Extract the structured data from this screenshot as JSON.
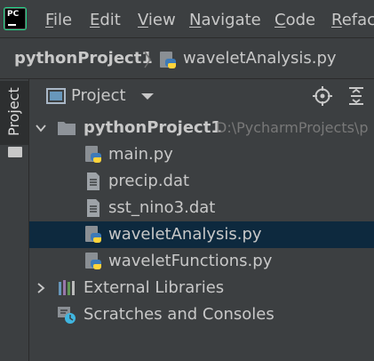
{
  "menu": {
    "items": [
      {
        "label": "File"
      },
      {
        "label": "Edit"
      },
      {
        "label": "View"
      },
      {
        "label": "Navigate"
      },
      {
        "label": "Code"
      },
      {
        "label": "Refac"
      }
    ]
  },
  "breadcrumb": {
    "project": "pythonProject1",
    "file": "waveletAnalysis.py"
  },
  "toolstrip": {
    "tab_label": "Project"
  },
  "panel": {
    "title": "Project",
    "root": {
      "name": "pythonProject1",
      "path": "D:\\PycharmProjects\\p"
    },
    "files": [
      {
        "name": "main.py",
        "icon": "python-file-icon"
      },
      {
        "name": "precip.dat",
        "icon": "text-file-icon"
      },
      {
        "name": "sst_nino3.dat",
        "icon": "text-file-icon"
      },
      {
        "name": "waveletAnalysis.py",
        "icon": "python-file-icon",
        "selected": true
      },
      {
        "name": "waveletFunctions.py",
        "icon": "python-file-icon"
      }
    ],
    "external_libraries": "External Libraries",
    "scratches": "Scratches and Consoles"
  },
  "colors": {
    "background": "#3c3f41",
    "selection": "#0d293e",
    "text": "#c8c8c8",
    "path_text": "#787878",
    "python_blue": "#3d7ab8",
    "python_yellow": "#ffd43b"
  }
}
